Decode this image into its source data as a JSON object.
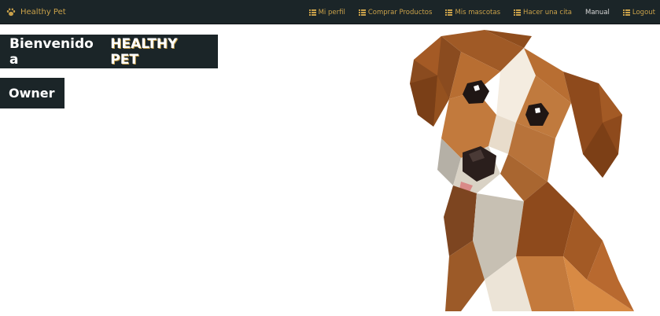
{
  "navbar": {
    "brand_label": "Healthy Pet",
    "brand_icon": "paw-icon",
    "items": [
      {
        "label": "Mi perfil",
        "icon": "list-icon"
      },
      {
        "label": "Comprar Productos",
        "icon": "list-icon"
      },
      {
        "label": "Mis mascotas",
        "icon": "list-icon"
      },
      {
        "label": "Hacer una cita",
        "icon": "list-icon"
      },
      {
        "label": "Manual",
        "icon": ""
      },
      {
        "label": "Logout",
        "icon": "list-icon"
      }
    ]
  },
  "hero": {
    "welcome": "Bienvenido a",
    "brand": "HEALTHY PET",
    "role": "Owner"
  },
  "illustration": "low-poly-dog",
  "colors": {
    "navbar_bg": "#1b2528",
    "accent_gold": "#c9a14a",
    "page_bg": "#ffffff"
  }
}
